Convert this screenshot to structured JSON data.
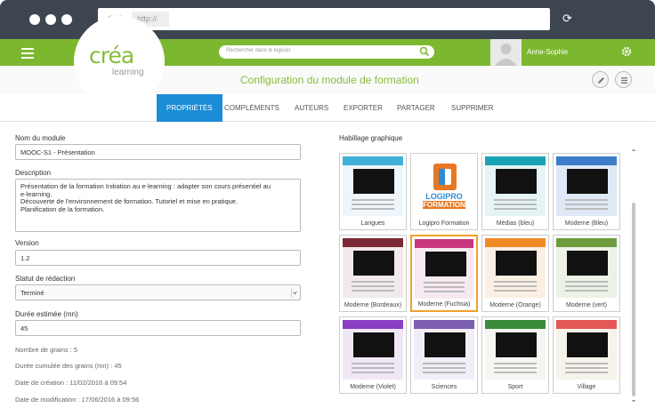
{
  "browser": {
    "url": "http://",
    "back": "<",
    "forward": ">"
  },
  "app": {
    "logo_main": "créa",
    "logo_sub": "learning",
    "search_placeholder": "Rechercher dans le logiciel",
    "username": "Anne-Sophie",
    "page_title": "Configuration du module de formation"
  },
  "tabs": [
    {
      "label": "PROPRIÉTÉS",
      "active": true
    },
    {
      "label": "COMPLÉMENTS"
    },
    {
      "label": "AUTEURS"
    },
    {
      "label": "EXPORTER"
    },
    {
      "label": "PARTAGER"
    },
    {
      "label": "SUPPRIMER"
    }
  ],
  "form": {
    "name_label": "Nom du module",
    "name_value": "MOOC-S1 - Présentation",
    "desc_label": "Description",
    "desc_lines": [
      "Présentation de la formation Initiation au e-learning : adapter son cours présentiel au",
      "e-learning.",
      "Découverte de l'environnement de formation. Tutoriel et mise en pratique.",
      "Planification de la formation."
    ],
    "version_label": "Version",
    "version_value": "1.2",
    "status_label": "Statut de rédaction",
    "status_value": "Terminé",
    "duration_label": "Durée estimée (mn)",
    "duration_value": "45",
    "grains_label": "Nombre de grains :",
    "grains_value": "5",
    "cumul_label": "Durée cumulée des grains (mn) :",
    "cumul_value": "45",
    "created_label": "Date de création :",
    "created_value": "11/02/2016 à 09:54",
    "modified_label": "Date de modification :",
    "modified_value": "17/06/2016 à 09:56"
  },
  "gallery": {
    "label": "Habillage graphique",
    "logo_text_1": "LOGIPRO",
    "logo_text_2": "FORMATION",
    "themes": [
      {
        "name": "Langues",
        "bg": "#eef6fb",
        "band": "#3fb0d8"
      },
      {
        "name": "Logipro Formation",
        "bg": "#ffffff",
        "band": "#e87722"
      },
      {
        "name": "Médias (bleu)",
        "bg": "#e6f4f6",
        "band": "#1aa3b4"
      },
      {
        "name": "Moderne (Bleu)",
        "bg": "#dfe9f6",
        "band": "#3d7cc8"
      },
      {
        "name": "Moderne (Bordeaux)",
        "bg": "#f2eaea",
        "band": "#7a2a35"
      },
      {
        "name": "Moderne (Fuchsia)",
        "bg": "#f6e9f1",
        "band": "#c8367f",
        "selected": true
      },
      {
        "name": "Moderne (Orange)",
        "bg": "#fbefe3",
        "band": "#ef8a25"
      },
      {
        "name": "Moderne (vert)",
        "bg": "#ecf2e6",
        "band": "#6d9b3e"
      },
      {
        "name": "Moderne (Violet)",
        "bg": "#f0e7f6",
        "band": "#8b3dc4"
      },
      {
        "name": "Sciences",
        "bg": "#f2eef8",
        "band": "#7d5fb0"
      },
      {
        "name": "Sport",
        "bg": "#f4f6f1",
        "band": "#3a8a3a"
      },
      {
        "name": "Village",
        "bg": "#f6f3ea",
        "band": "#e45757"
      }
    ]
  },
  "colors": {
    "brand_green": "#7cb82f",
    "tab_active": "#1a8cd8",
    "chrome": "#3d4650"
  }
}
